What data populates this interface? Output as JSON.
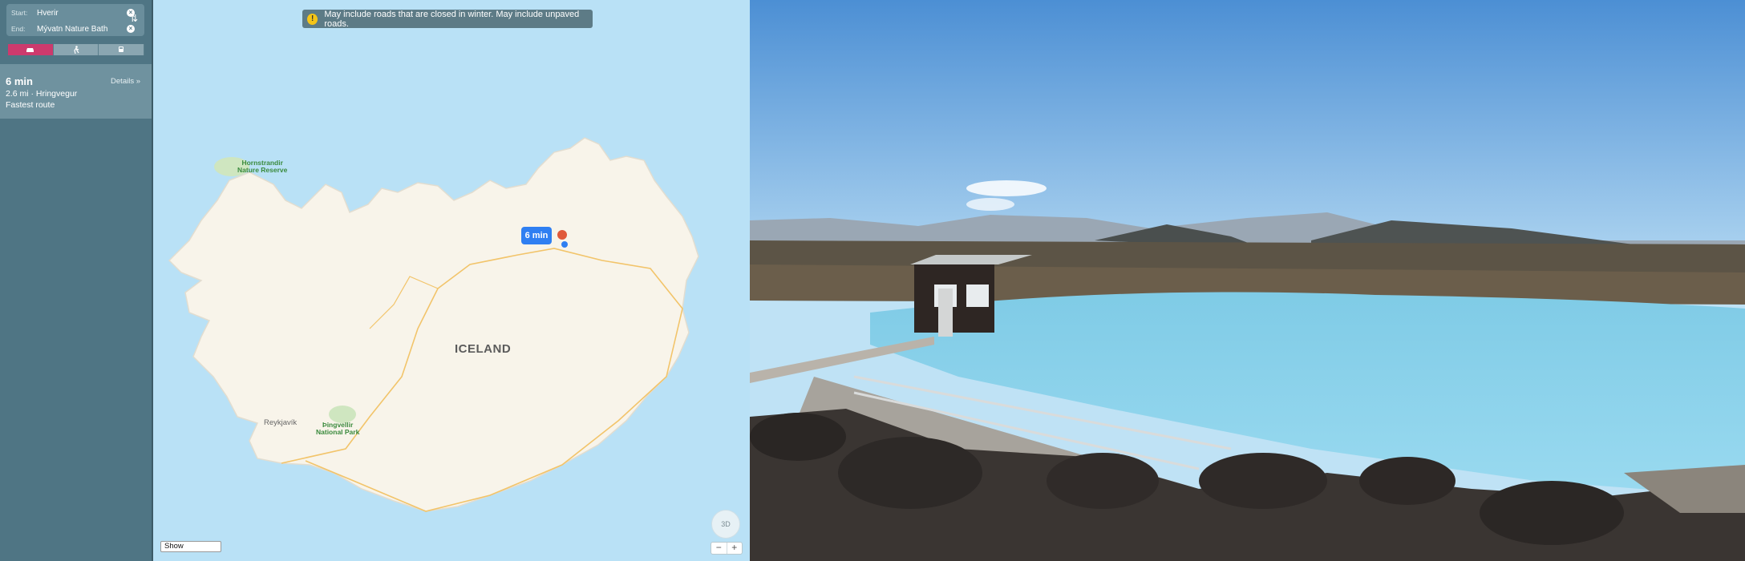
{
  "directions": {
    "start_label": "Start:",
    "start_value": "Hverir",
    "end_label": "End:",
    "end_value": "Mývatn Nature Bath",
    "modes": [
      {
        "icon": "car-icon",
        "active": true
      },
      {
        "icon": "walk-icon",
        "active": false
      },
      {
        "icon": "transit-icon",
        "active": false
      }
    ]
  },
  "route": {
    "time": "6 min",
    "details_link": "Details »",
    "distance_road": "2.6 mi · Hringvegur",
    "description": "Fastest route"
  },
  "map": {
    "warning": "May include roads that are closed in winter. May include unpaved roads.",
    "country_label": "ICELAND",
    "park_1": "Hornstrandir\nNature Reserve",
    "park_2": "Þingvellir\nNational Park",
    "city": "Reykjavík",
    "route_bubble": "6 min",
    "show_select": "Show",
    "compass_label": "3D"
  }
}
